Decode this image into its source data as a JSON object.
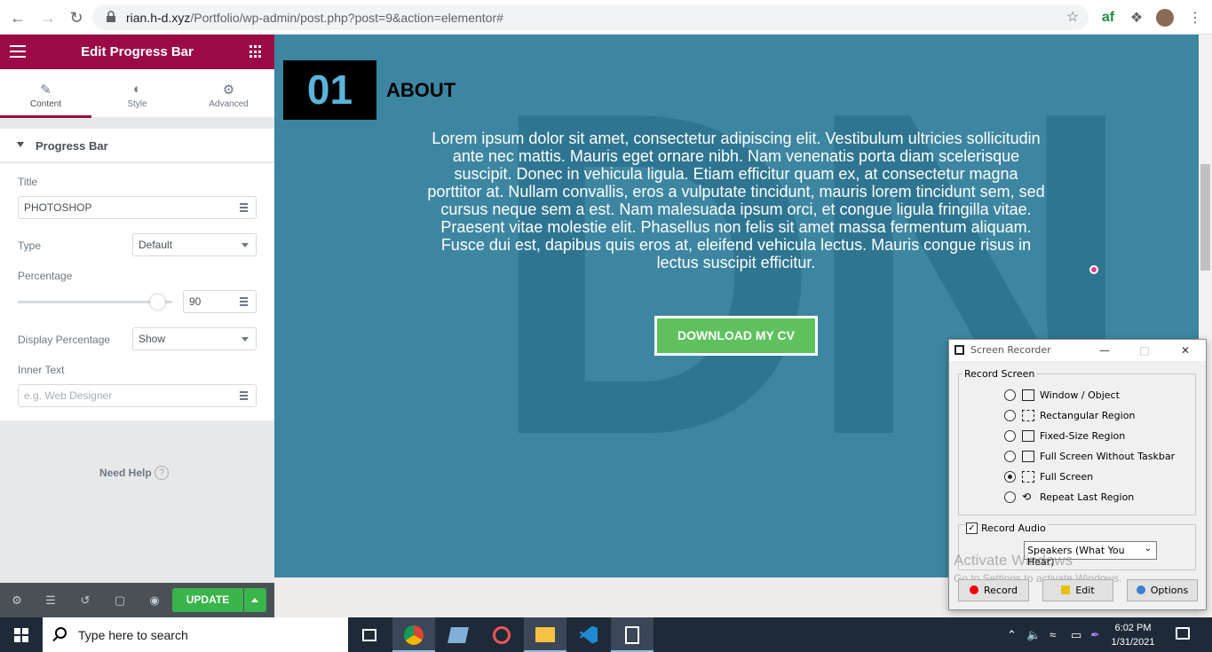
{
  "browser": {
    "url_host": "rian.h-d.xyz",
    "url_path": "/Portfolio/wp-admin/post.php?post=9&action=elementor#"
  },
  "panel": {
    "title": "Edit Progress Bar",
    "tabs": [
      {
        "label": "Content",
        "icon": "pencil-icon"
      },
      {
        "label": "Style",
        "icon": "half-circle-icon"
      },
      {
        "label": "Advanced",
        "icon": "gear-icon"
      }
    ],
    "section_label": "Progress Bar",
    "title_label": "Title",
    "title_value": "PHOTOSHOP",
    "type_label": "Type",
    "type_value": "Default",
    "percentage_label": "Percentage",
    "percentage_value": "90",
    "percentage_fraction": 0.9,
    "display_percentage_label": "Display Percentage",
    "display_percentage_value": "Show",
    "inner_text_label": "Inner Text",
    "inner_text_placeholder": "e.g. Web Designer",
    "need_help": "Need Help",
    "update_label": "UPDATE",
    "accent_color": "#9b0a46",
    "update_color": "#39b54a"
  },
  "canvas": {
    "watermark": "DN",
    "number": "01",
    "heading": "ABOUT",
    "body": "Lorem ipsum dolor sit amet, consectetur adipiscing elit. Vestibulum ultricies sollicitudin ante nec mattis. Mauris eget ornare nibh. Nam venenatis porta diam scelerisque suscipit. Donec in vehicula ligula. Etiam efficitur quam ex, at consectetur magna porttitor at. Nullam convallis, eros a vulputate tincidunt, mauris lorem tincidunt sem, sed cursus neque sem a est. Nam malesuada ipsum orci, et congue ligula fringilla vitae. Praesent vitae molestie elit. Phasellus non felis sit amet massa fermentum aliquam. Fusce dui est, dapibus quis eros at, eleifend vehicula lectus. Mauris congue risus in lectus suscipit efficitur.",
    "button": "DOWNLOAD MY CV",
    "background_color": "#3d86a1"
  },
  "recorder": {
    "title": "Screen Recorder",
    "group_label": "Record Screen",
    "options": [
      {
        "label": "Window / Object",
        "selected": false
      },
      {
        "label": "Rectangular Region",
        "selected": false
      },
      {
        "label": "Fixed-Size Region",
        "selected": false
      },
      {
        "label": "Full Screen Without Taskbar",
        "selected": false
      },
      {
        "label": "Full Screen",
        "selected": true
      },
      {
        "label": "Repeat Last Region",
        "selected": false
      }
    ],
    "audio_label": "Record Audio",
    "audio_checked": true,
    "audio_source": "Speakers (What You Hear)",
    "activate_title": "Activate Windows",
    "activate_sub": "Go to Settings to activate Windows.",
    "buttons": {
      "record": "Record",
      "edit": "Edit",
      "options": "Options"
    }
  },
  "taskbar": {
    "search_placeholder": "Type here to search",
    "time": "6:02 PM",
    "date": "1/31/2021"
  }
}
